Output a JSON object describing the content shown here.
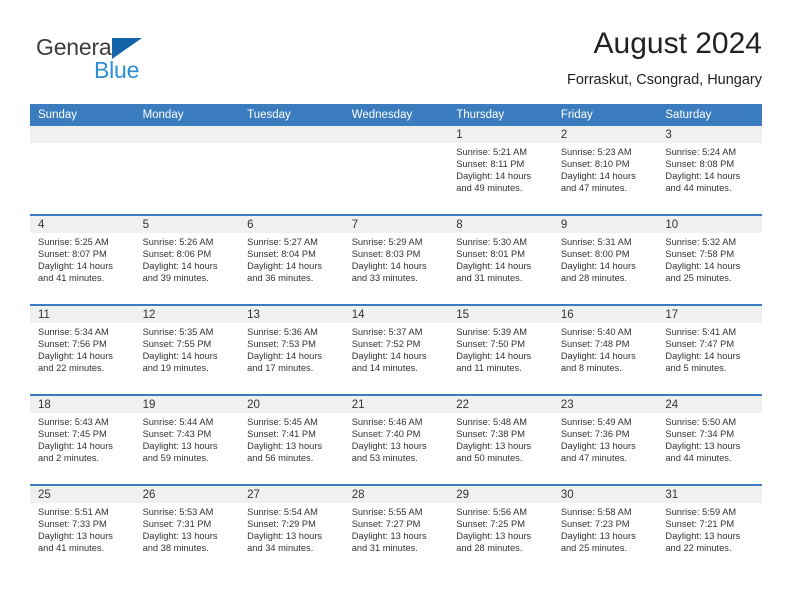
{
  "brand": {
    "name_part1": "General",
    "name_part2": "Blue",
    "logo_icon": "triangle-logo-icon"
  },
  "header": {
    "month_title": "August 2024",
    "location": "Forraskut, Csongrad, Hungary"
  },
  "calendar": {
    "weekday_headers": [
      "Sunday",
      "Monday",
      "Tuesday",
      "Wednesday",
      "Thursday",
      "Friday",
      "Saturday"
    ],
    "colors": {
      "header_blue": "#3a7cbe",
      "daynum_band": "#f0f0f0",
      "brand_blue": "#1464aa",
      "brand_light_blue": "#2d8fd5"
    },
    "weeks": [
      [
        {
          "day": "",
          "sunrise": "",
          "sunset": "",
          "daylight_line1": "",
          "daylight_line2": "",
          "empty": true
        },
        {
          "day": "",
          "sunrise": "",
          "sunset": "",
          "daylight_line1": "",
          "daylight_line2": "",
          "empty": true
        },
        {
          "day": "",
          "sunrise": "",
          "sunset": "",
          "daylight_line1": "",
          "daylight_line2": "",
          "empty": true
        },
        {
          "day": "",
          "sunrise": "",
          "sunset": "",
          "daylight_line1": "",
          "daylight_line2": "",
          "empty": true
        },
        {
          "day": "1",
          "sunrise": "Sunrise: 5:21 AM",
          "sunset": "Sunset: 8:11 PM",
          "daylight_line1": "Daylight: 14 hours",
          "daylight_line2": "and 49 minutes.",
          "empty": false
        },
        {
          "day": "2",
          "sunrise": "Sunrise: 5:23 AM",
          "sunset": "Sunset: 8:10 PM",
          "daylight_line1": "Daylight: 14 hours",
          "daylight_line2": "and 47 minutes.",
          "empty": false
        },
        {
          "day": "3",
          "sunrise": "Sunrise: 5:24 AM",
          "sunset": "Sunset: 8:08 PM",
          "daylight_line1": "Daylight: 14 hours",
          "daylight_line2": "and 44 minutes.",
          "empty": false
        }
      ],
      [
        {
          "day": "4",
          "sunrise": "Sunrise: 5:25 AM",
          "sunset": "Sunset: 8:07 PM",
          "daylight_line1": "Daylight: 14 hours",
          "daylight_line2": "and 41 minutes.",
          "empty": false
        },
        {
          "day": "5",
          "sunrise": "Sunrise: 5:26 AM",
          "sunset": "Sunset: 8:06 PM",
          "daylight_line1": "Daylight: 14 hours",
          "daylight_line2": "and 39 minutes.",
          "empty": false
        },
        {
          "day": "6",
          "sunrise": "Sunrise: 5:27 AM",
          "sunset": "Sunset: 8:04 PM",
          "daylight_line1": "Daylight: 14 hours",
          "daylight_line2": "and 36 minutes.",
          "empty": false
        },
        {
          "day": "7",
          "sunrise": "Sunrise: 5:29 AM",
          "sunset": "Sunset: 8:03 PM",
          "daylight_line1": "Daylight: 14 hours",
          "daylight_line2": "and 33 minutes.",
          "empty": false
        },
        {
          "day": "8",
          "sunrise": "Sunrise: 5:30 AM",
          "sunset": "Sunset: 8:01 PM",
          "daylight_line1": "Daylight: 14 hours",
          "daylight_line2": "and 31 minutes.",
          "empty": false
        },
        {
          "day": "9",
          "sunrise": "Sunrise: 5:31 AM",
          "sunset": "Sunset: 8:00 PM",
          "daylight_line1": "Daylight: 14 hours",
          "daylight_line2": "and 28 minutes.",
          "empty": false
        },
        {
          "day": "10",
          "sunrise": "Sunrise: 5:32 AM",
          "sunset": "Sunset: 7:58 PM",
          "daylight_line1": "Daylight: 14 hours",
          "daylight_line2": "and 25 minutes.",
          "empty": false
        }
      ],
      [
        {
          "day": "11",
          "sunrise": "Sunrise: 5:34 AM",
          "sunset": "Sunset: 7:56 PM",
          "daylight_line1": "Daylight: 14 hours",
          "daylight_line2": "and 22 minutes.",
          "empty": false
        },
        {
          "day": "12",
          "sunrise": "Sunrise: 5:35 AM",
          "sunset": "Sunset: 7:55 PM",
          "daylight_line1": "Daylight: 14 hours",
          "daylight_line2": "and 19 minutes.",
          "empty": false
        },
        {
          "day": "13",
          "sunrise": "Sunrise: 5:36 AM",
          "sunset": "Sunset: 7:53 PM",
          "daylight_line1": "Daylight: 14 hours",
          "daylight_line2": "and 17 minutes.",
          "empty": false
        },
        {
          "day": "14",
          "sunrise": "Sunrise: 5:37 AM",
          "sunset": "Sunset: 7:52 PM",
          "daylight_line1": "Daylight: 14 hours",
          "daylight_line2": "and 14 minutes.",
          "empty": false
        },
        {
          "day": "15",
          "sunrise": "Sunrise: 5:39 AM",
          "sunset": "Sunset: 7:50 PM",
          "daylight_line1": "Daylight: 14 hours",
          "daylight_line2": "and 11 minutes.",
          "empty": false
        },
        {
          "day": "16",
          "sunrise": "Sunrise: 5:40 AM",
          "sunset": "Sunset: 7:48 PM",
          "daylight_line1": "Daylight: 14 hours",
          "daylight_line2": "and 8 minutes.",
          "empty": false
        },
        {
          "day": "17",
          "sunrise": "Sunrise: 5:41 AM",
          "sunset": "Sunset: 7:47 PM",
          "daylight_line1": "Daylight: 14 hours",
          "daylight_line2": "and 5 minutes.",
          "empty": false
        }
      ],
      [
        {
          "day": "18",
          "sunrise": "Sunrise: 5:43 AM",
          "sunset": "Sunset: 7:45 PM",
          "daylight_line1": "Daylight: 14 hours",
          "daylight_line2": "and 2 minutes.",
          "empty": false
        },
        {
          "day": "19",
          "sunrise": "Sunrise: 5:44 AM",
          "sunset": "Sunset: 7:43 PM",
          "daylight_line1": "Daylight: 13 hours",
          "daylight_line2": "and 59 minutes.",
          "empty": false
        },
        {
          "day": "20",
          "sunrise": "Sunrise: 5:45 AM",
          "sunset": "Sunset: 7:41 PM",
          "daylight_line1": "Daylight: 13 hours",
          "daylight_line2": "and 56 minutes.",
          "empty": false
        },
        {
          "day": "21",
          "sunrise": "Sunrise: 5:46 AM",
          "sunset": "Sunset: 7:40 PM",
          "daylight_line1": "Daylight: 13 hours",
          "daylight_line2": "and 53 minutes.",
          "empty": false
        },
        {
          "day": "22",
          "sunrise": "Sunrise: 5:48 AM",
          "sunset": "Sunset: 7:38 PM",
          "daylight_line1": "Daylight: 13 hours",
          "daylight_line2": "and 50 minutes.",
          "empty": false
        },
        {
          "day": "23",
          "sunrise": "Sunrise: 5:49 AM",
          "sunset": "Sunset: 7:36 PM",
          "daylight_line1": "Daylight: 13 hours",
          "daylight_line2": "and 47 minutes.",
          "empty": false
        },
        {
          "day": "24",
          "sunrise": "Sunrise: 5:50 AM",
          "sunset": "Sunset: 7:34 PM",
          "daylight_line1": "Daylight: 13 hours",
          "daylight_line2": "and 44 minutes.",
          "empty": false
        }
      ],
      [
        {
          "day": "25",
          "sunrise": "Sunrise: 5:51 AM",
          "sunset": "Sunset: 7:33 PM",
          "daylight_line1": "Daylight: 13 hours",
          "daylight_line2": "and 41 minutes.",
          "empty": false
        },
        {
          "day": "26",
          "sunrise": "Sunrise: 5:53 AM",
          "sunset": "Sunset: 7:31 PM",
          "daylight_line1": "Daylight: 13 hours",
          "daylight_line2": "and 38 minutes.",
          "empty": false
        },
        {
          "day": "27",
          "sunrise": "Sunrise: 5:54 AM",
          "sunset": "Sunset: 7:29 PM",
          "daylight_line1": "Daylight: 13 hours",
          "daylight_line2": "and 34 minutes.",
          "empty": false
        },
        {
          "day": "28",
          "sunrise": "Sunrise: 5:55 AM",
          "sunset": "Sunset: 7:27 PM",
          "daylight_line1": "Daylight: 13 hours",
          "daylight_line2": "and 31 minutes.",
          "empty": false
        },
        {
          "day": "29",
          "sunrise": "Sunrise: 5:56 AM",
          "sunset": "Sunset: 7:25 PM",
          "daylight_line1": "Daylight: 13 hours",
          "daylight_line2": "and 28 minutes.",
          "empty": false
        },
        {
          "day": "30",
          "sunrise": "Sunrise: 5:58 AM",
          "sunset": "Sunset: 7:23 PM",
          "daylight_line1": "Daylight: 13 hours",
          "daylight_line2": "and 25 minutes.",
          "empty": false
        },
        {
          "day": "31",
          "sunrise": "Sunrise: 5:59 AM",
          "sunset": "Sunset: 7:21 PM",
          "daylight_line1": "Daylight: 13 hours",
          "daylight_line2": "and 22 minutes.",
          "empty": false
        }
      ]
    ]
  }
}
